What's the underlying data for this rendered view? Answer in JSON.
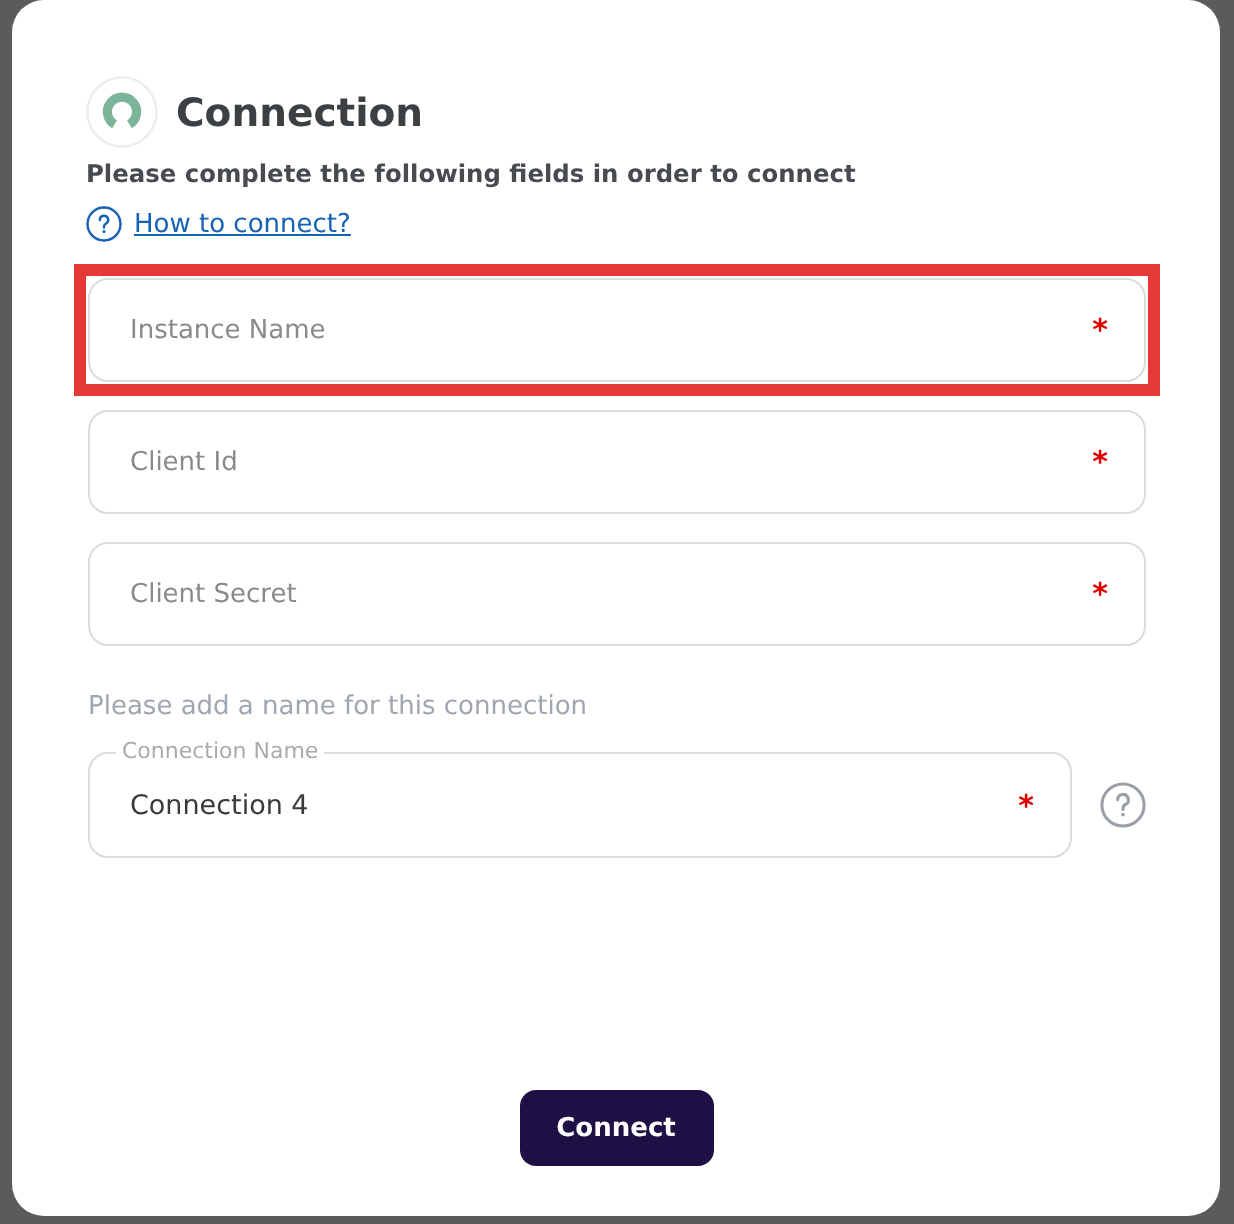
{
  "dialog": {
    "title": "Connection",
    "subtitle": "Please complete the following fields in order to connect",
    "help_link": "How to connect?"
  },
  "fields": [
    {
      "placeholder": "Instance Name",
      "required_mark": "*",
      "highlighted": true
    },
    {
      "placeholder": "Client Id",
      "required_mark": "*",
      "highlighted": false
    },
    {
      "placeholder": "Client Secret",
      "required_mark": "*",
      "highlighted": false
    }
  ],
  "name_section": {
    "hint": "Please add a name for this connection",
    "field": {
      "label": "Connection Name",
      "value": "Connection 4",
      "required_mark": "*"
    }
  },
  "button": {
    "label": "Connect"
  }
}
